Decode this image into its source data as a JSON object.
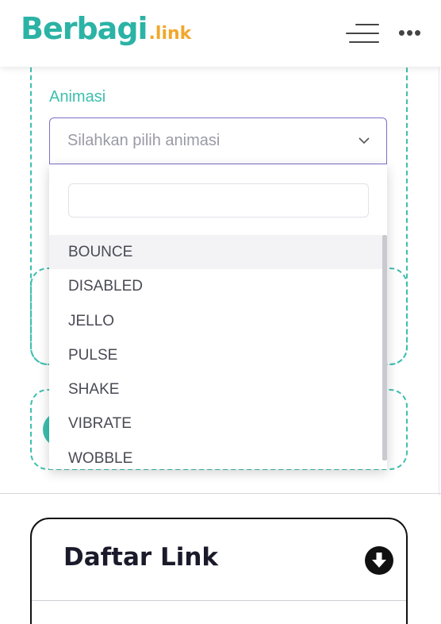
{
  "header": {
    "logo_main": "Berbagi",
    "logo_dot": ".",
    "logo_tld": "link"
  },
  "form": {
    "animation_label": "Animasi",
    "animation_placeholder": "Silahkan pilih animasi"
  },
  "dropdown": {
    "search_value": "",
    "options": [
      "BOUNCE",
      "DISABLED",
      "JELLO",
      "PULSE",
      "SHAKE",
      "VIBRATE",
      "WOBBLE"
    ],
    "highlighted": "BOUNCE"
  },
  "section": {
    "title": "Daftar Link"
  },
  "colors": {
    "accent": "#3dbfae",
    "logo_orange": "#f2a72b",
    "select_border": "#7b70c9"
  }
}
